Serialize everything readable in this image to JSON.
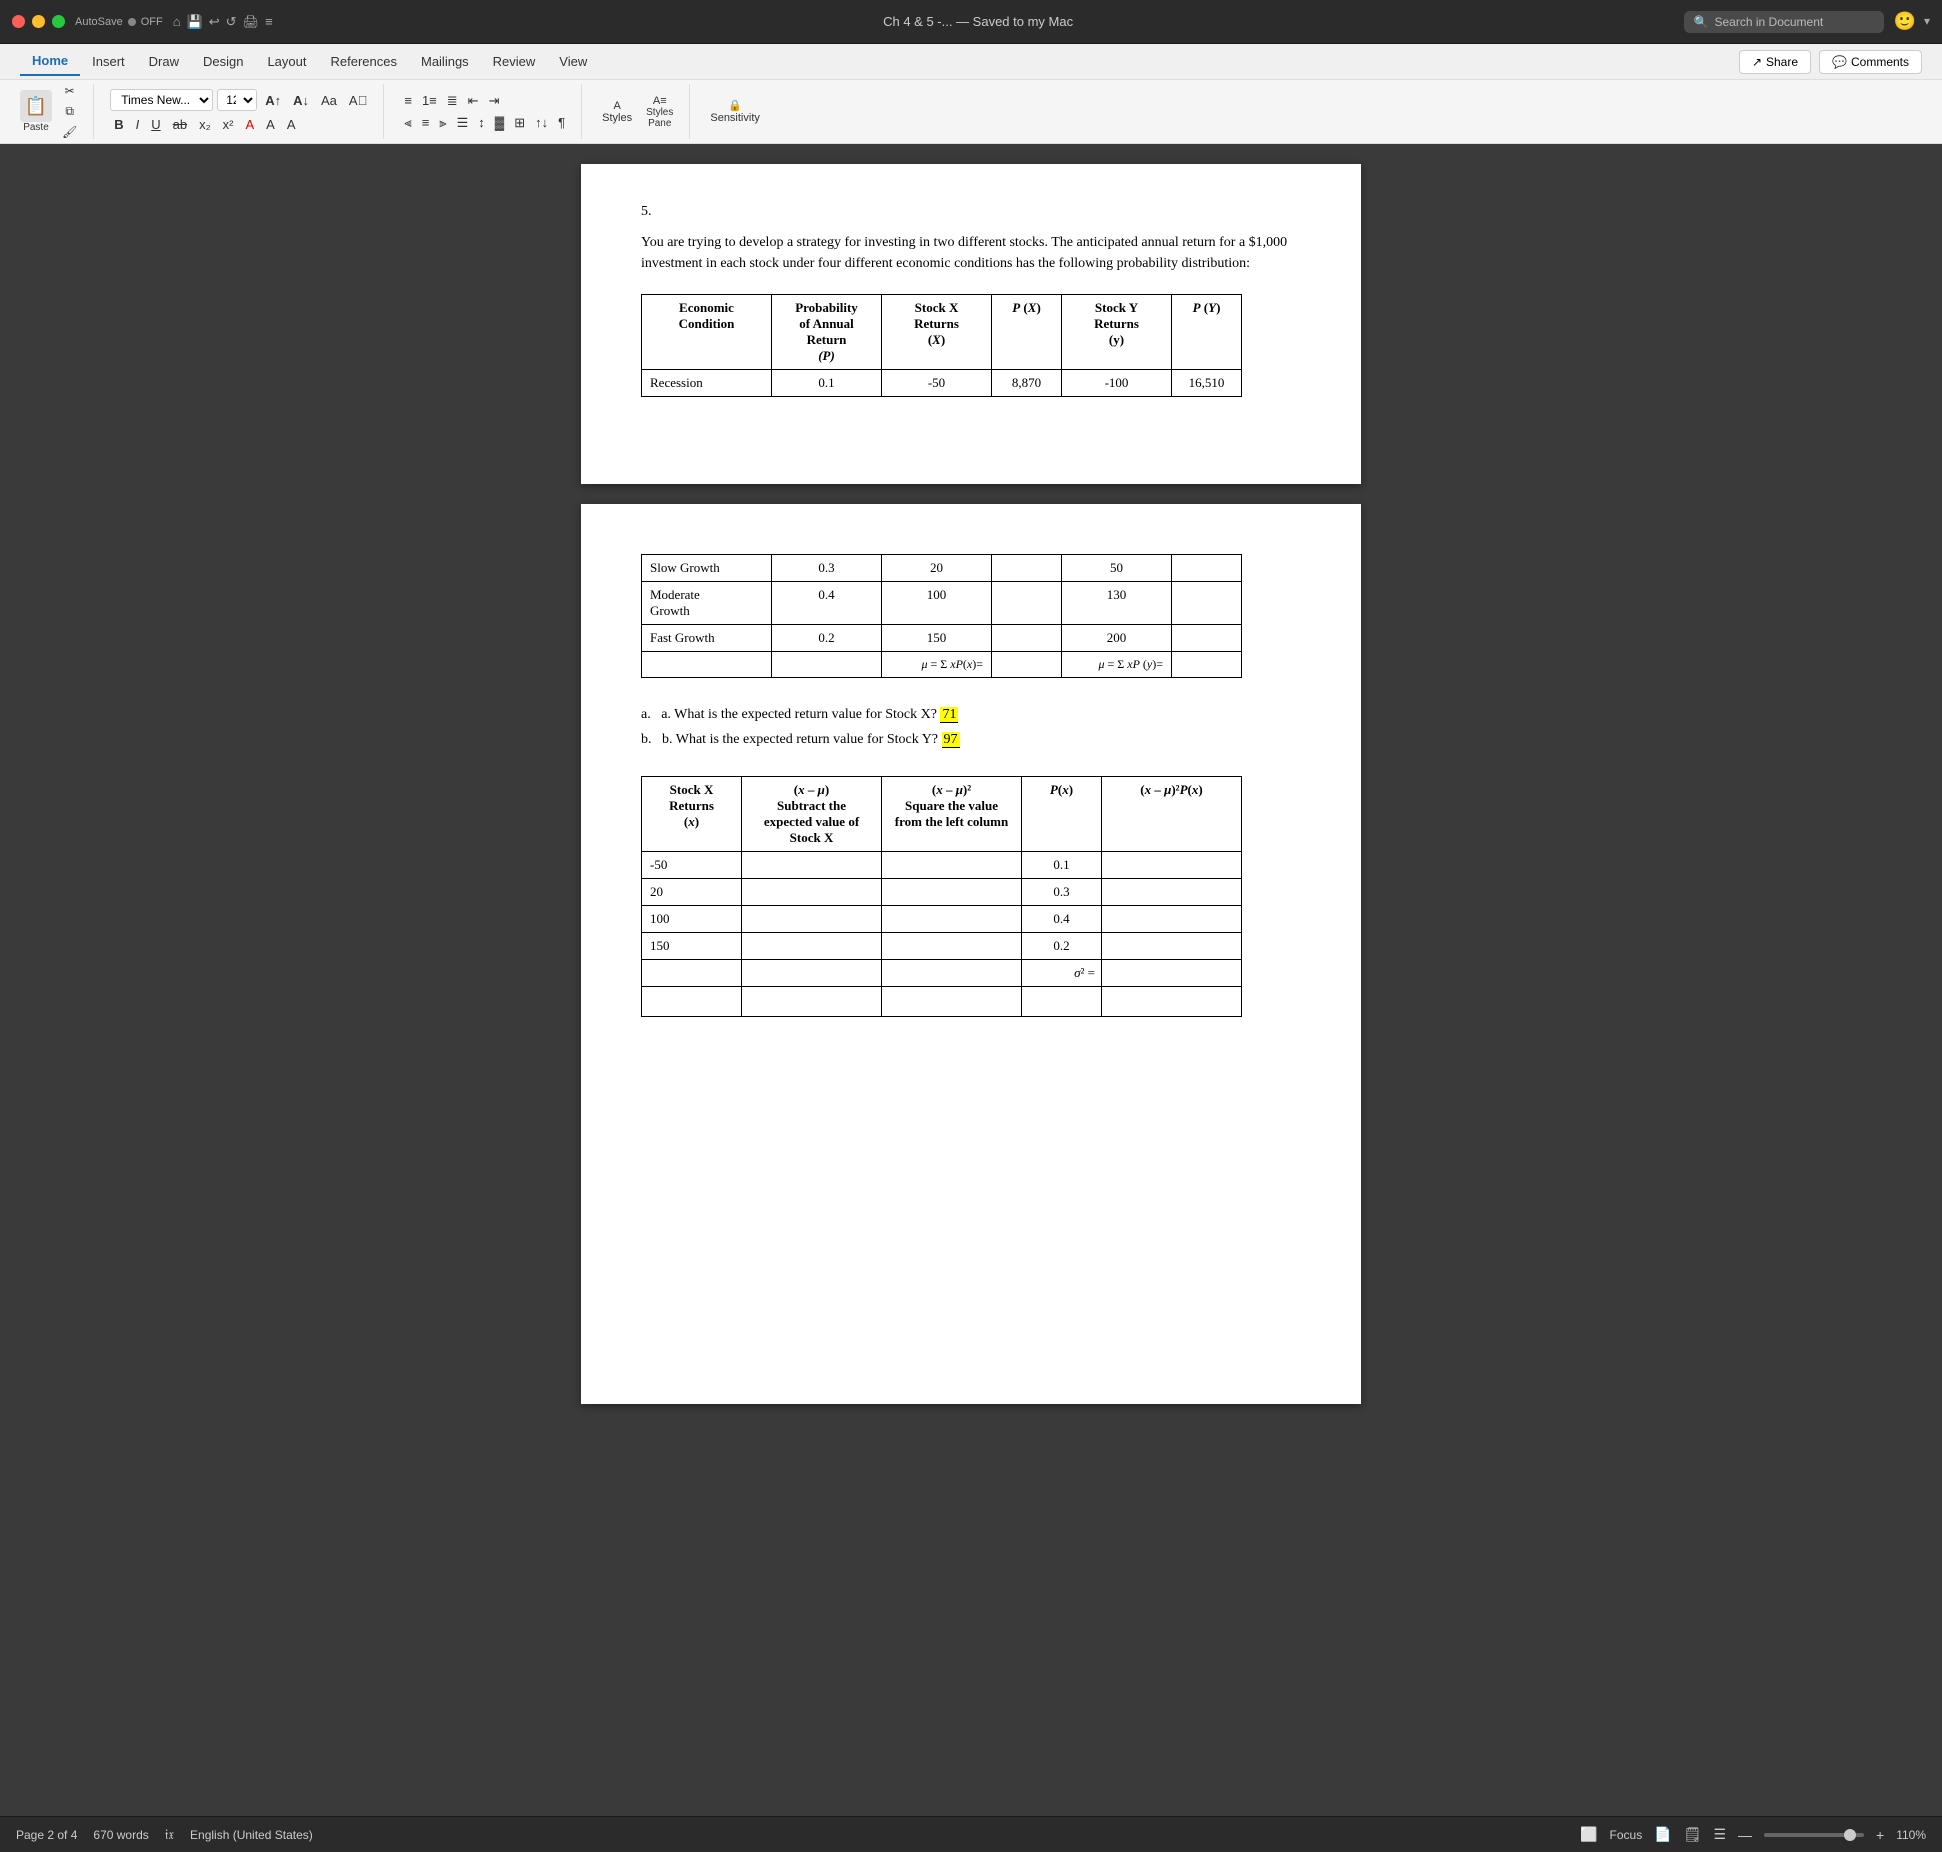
{
  "titlebar": {
    "autosave_label": "AutoSave",
    "autosave_state": "OFF",
    "doc_title": "Ch 4 & 5 -... — Saved to my Mac",
    "search_placeholder": "Search in Document",
    "emoji_btn": "🙂"
  },
  "ribbon": {
    "tabs": [
      "Home",
      "Insert",
      "Draw",
      "Design",
      "Layout",
      "References",
      "Mailings",
      "Review",
      "View"
    ],
    "active_tab": "Home",
    "share_label": "Share",
    "comments_label": "Comments",
    "font_name": "Times New...",
    "font_size": "12",
    "paste_label": "Paste",
    "sensitivity_label": "Sensitivity",
    "styles_label": "Styles",
    "styles_pane_label": "Styles\nPane"
  },
  "page1": {
    "problem_number": "5.",
    "problem_text": "You are trying to develop a strategy for investing in two different stocks. The anticipated annual return for a $1,000 investment in each stock under four different economic conditions has the following probability distribution:",
    "table_headers": [
      "Economic Condition",
      "Probability of Annual Return (P)",
      "Stock X Returns (X)",
      "P (X)",
      "Stock Y Returns (y)",
      "P (Y)"
    ],
    "table_rows": [
      [
        "Recession",
        "0.1",
        "-50",
        "8,870",
        "-100",
        "16,510"
      ]
    ]
  },
  "page2": {
    "table1_rows": [
      [
        "Slow Growth",
        "0.3",
        "20",
        "",
        "50",
        ""
      ],
      [
        "Moderate Growth",
        "0.4",
        "100",
        "",
        "130",
        ""
      ],
      [
        "Fast Growth",
        "0.2",
        "150",
        "",
        "200",
        ""
      ]
    ],
    "mu_x_label": "μ = Σ xP(x)=",
    "mu_y_label": "μ = Σ xP (y)=",
    "question_a": "a.  What is the expected return value for Stock X?",
    "answer_a": "71",
    "question_b": "b.  What is the expected return value for Stock Y?",
    "answer_b": "97",
    "table2_headers": [
      "Stock X Returns (x)",
      "(x – μ)\nSubtract the expected value of Stock X",
      "(x – μ)²\nSquare the value from the left column",
      "P(x)",
      "(x – μ)²P(x)"
    ],
    "table2_rows": [
      [
        "-50",
        "",
        "",
        "0.1",
        ""
      ],
      [
        "20",
        "",
        "",
        "0.3",
        ""
      ],
      [
        "100",
        "",
        "",
        "0.4",
        ""
      ],
      [
        "150",
        "",
        "",
        "0.2",
        ""
      ]
    ],
    "sigma_label": "σ² ="
  },
  "statusbar": {
    "page_info": "Page 2 of 4",
    "word_count": "670 words",
    "language": "English (United States)",
    "focus_label": "Focus",
    "zoom_level": "110%"
  }
}
